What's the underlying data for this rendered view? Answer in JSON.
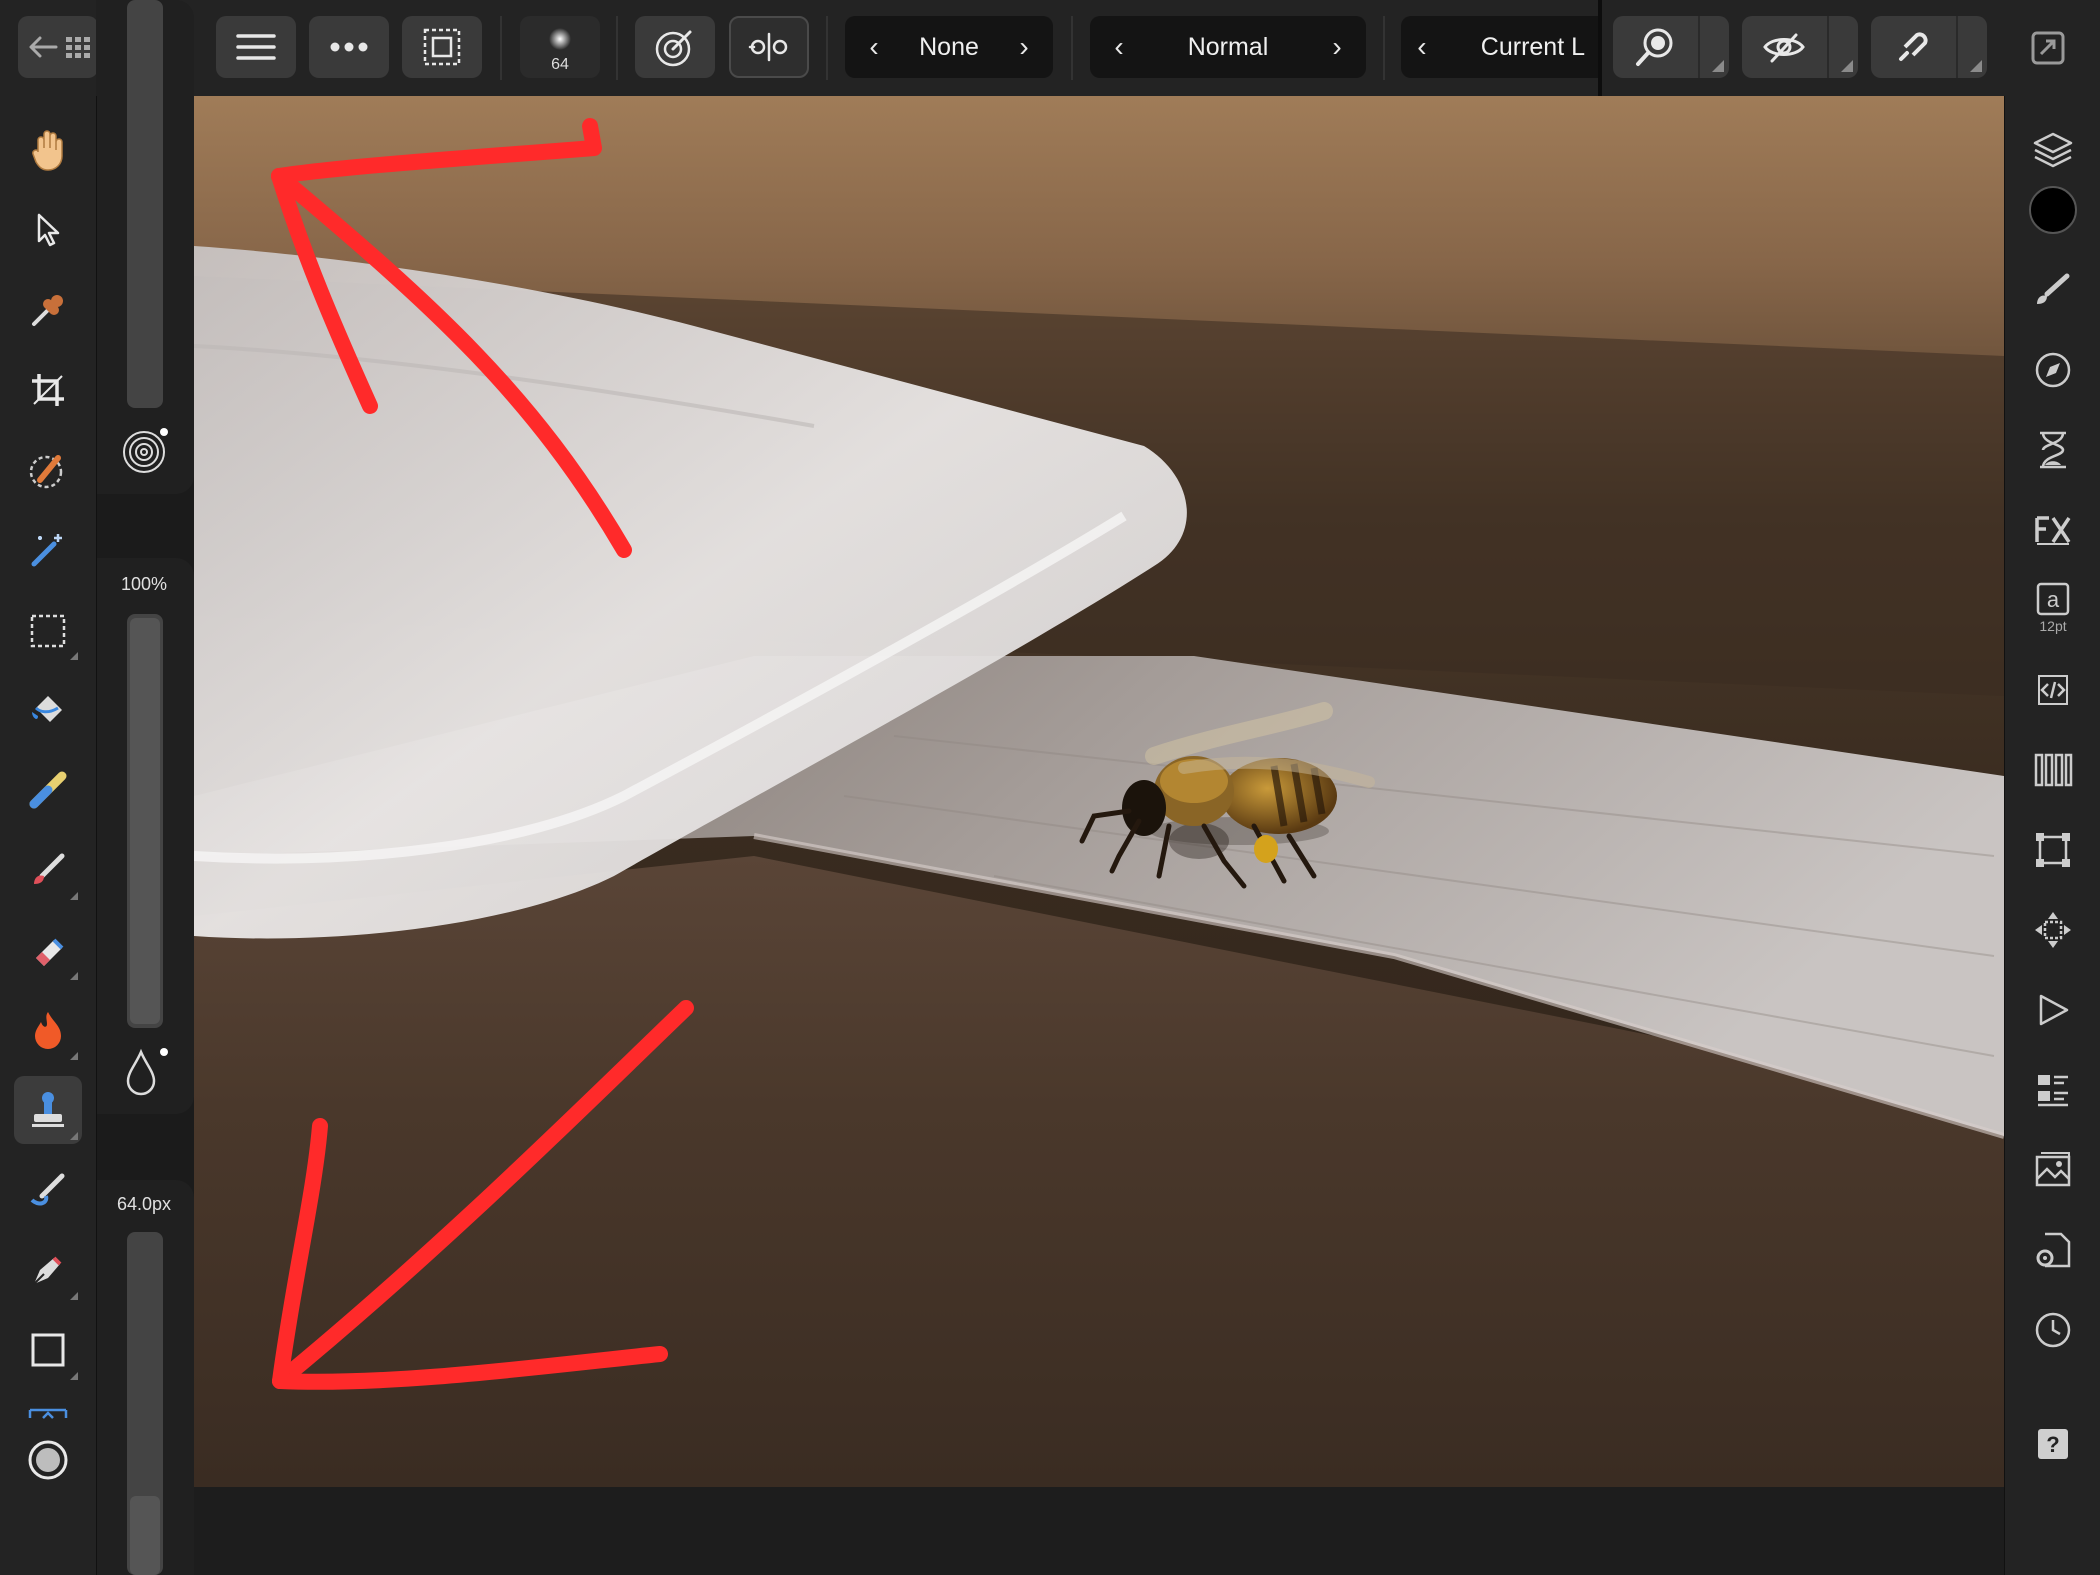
{
  "toolbar": {
    "brush_size_badge": "64",
    "stepper_source": {
      "value": "None"
    },
    "stepper_blend": {
      "value": "Normal"
    },
    "stepper_layer": {
      "value": "Current L"
    }
  },
  "context_panel": {
    "opacity_label": "100%",
    "opacity_value": 1.0,
    "width_label": "64.0px"
  },
  "right_studio": {
    "character_size_label": "12pt"
  },
  "left_tools": {
    "active": "clone-tool"
  },
  "colors": {
    "app_bg": "#1b1b1b",
    "toolbar_bg": "#232323",
    "button_bg": "#3a3a3a",
    "annotation_red": "#ff2a2a",
    "primary_color_swatch": "#000000"
  }
}
